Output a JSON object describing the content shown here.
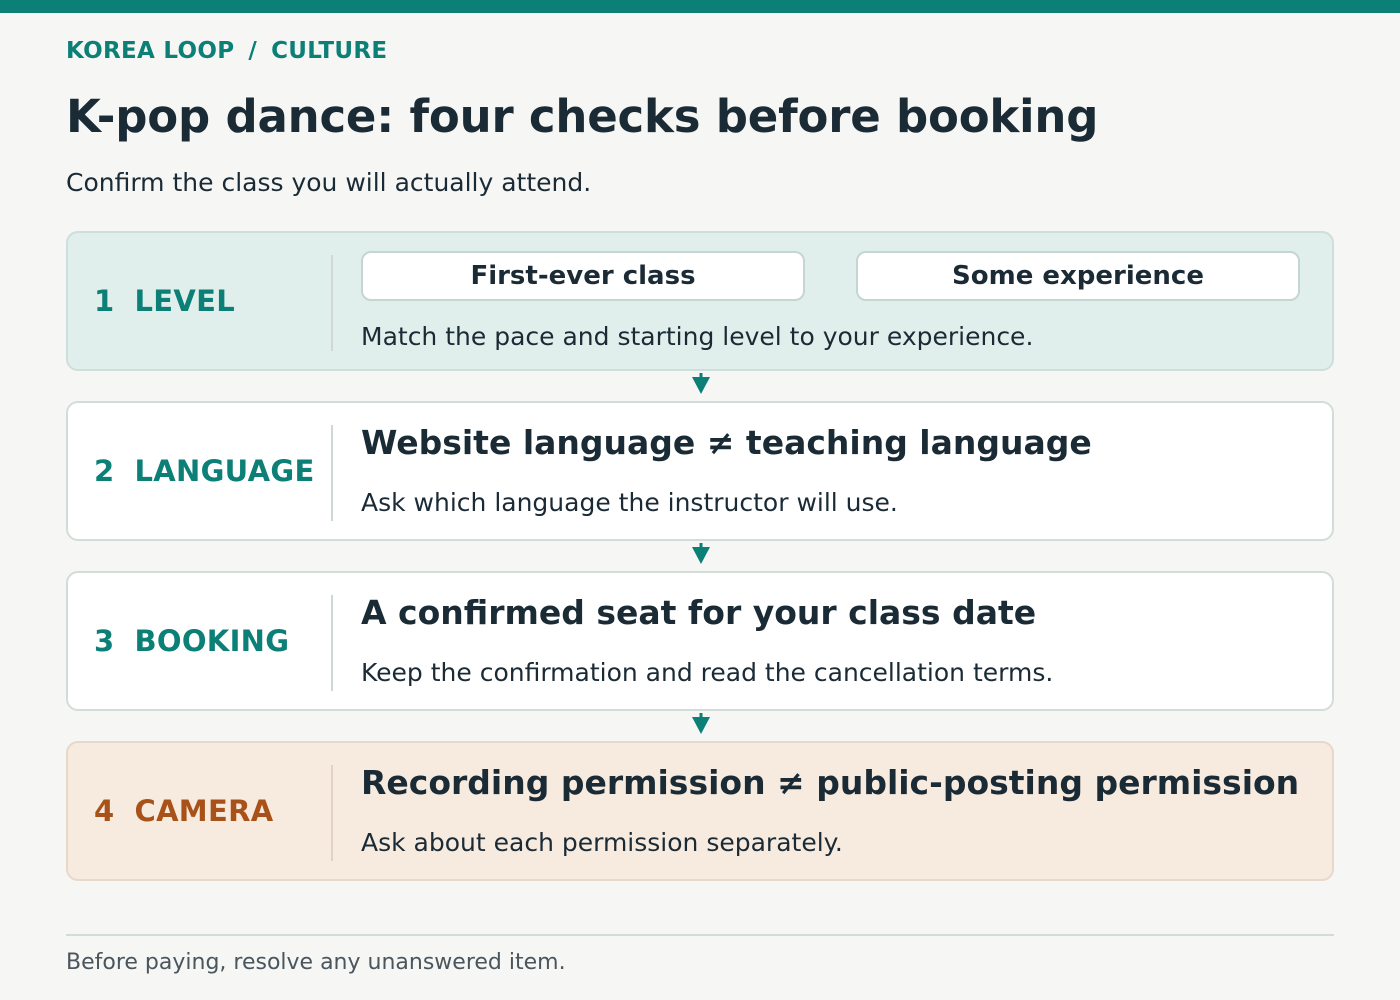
{
  "breadcrumb": {
    "site": "KOREA LOOP",
    "separator": "/",
    "section": "CULTURE"
  },
  "page": {
    "title": "K-pop dance: four checks before booking",
    "subtitle": "Confirm the class you will actually attend."
  },
  "steps": [
    {
      "number": "1",
      "label": "LEVEL",
      "options": [
        "First-ever class",
        "Some experience"
      ],
      "description": "Match the pace and starting level to your experience."
    },
    {
      "number": "2",
      "label": "LANGUAGE",
      "heading": "Website language ≠ teaching language",
      "description": "Ask which language the instructor will use."
    },
    {
      "number": "3",
      "label": "BOOKING",
      "heading": "A confirmed seat for your class date",
      "description": "Keep the confirmation and read the cancellation terms."
    },
    {
      "number": "4",
      "label": "CAMERA",
      "heading": "Recording permission ≠ public-posting permission",
      "description": "Ask about each permission separately."
    }
  ],
  "footer": {
    "note": "Before paying, resolve any unanswered item."
  },
  "colors": {
    "accent": "#0c7f77",
    "warning": "#a85219",
    "level_card_bg": "#e1efec",
    "camera_card_bg": "#f7eadf",
    "text": "#1b2b36"
  },
  "icons": {
    "connector": "arrow-down-icon"
  }
}
